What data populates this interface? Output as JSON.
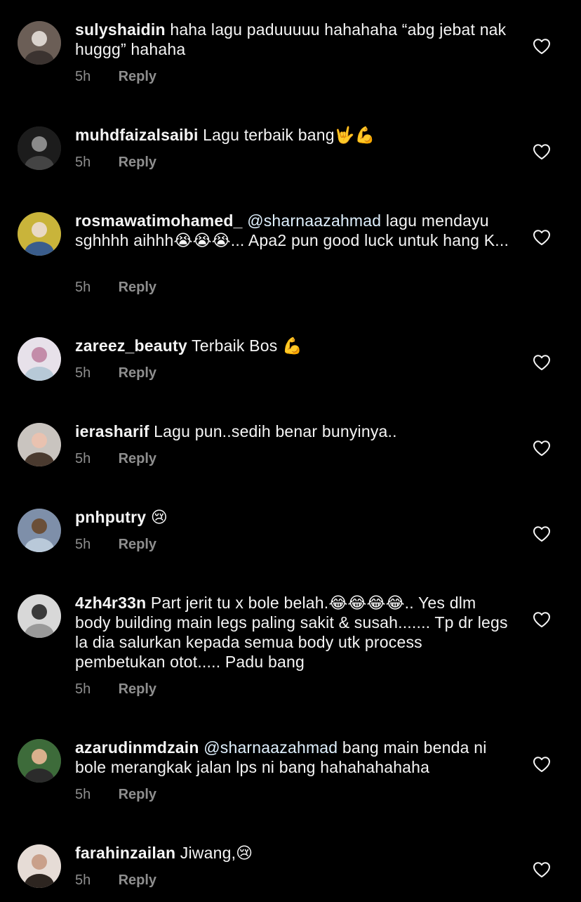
{
  "comments": [
    {
      "username": "sulyshaidin",
      "text": "haha lagu paduuuuu hahahaha “abg jebat nak huggg” hahaha",
      "time": "5h",
      "reply_label": "Reply",
      "avatar_colors": [
        "#6b5e56",
        "#d9d2cc",
        "#3b3330"
      ]
    },
    {
      "username": "muhdfaizalsaibi",
      "text": "Lagu terbaik bang🤟💪",
      "time": "5h",
      "reply_label": "Reply",
      "avatar_colors": [
        "#1c1c1c",
        "#8a8a8a",
        "#444444"
      ]
    },
    {
      "username": "rosmawatimohamed_",
      "mention": "@sharnaazahmad",
      "text": " lagu mendayu sghhhh aihhh😭😭😭... Apa2 pun good luck untuk hang K...",
      "time": "5h",
      "reply_label": "Reply",
      "avatar_colors": [
        "#c9b43a",
        "#e9d9c3",
        "#3a5d8c"
      ]
    },
    {
      "username": "zareez_beauty",
      "text": "Terbaik Bos 💪",
      "time": "5h",
      "reply_label": "Reply",
      "avatar_colors": [
        "#e7e1ea",
        "#c38ca9",
        "#b7c9d7"
      ]
    },
    {
      "username": "ierasharif",
      "text": "Lagu pun..sedih benar bunyinya..",
      "time": "5h",
      "reply_label": "Reply",
      "avatar_colors": [
        "#c9c4bf",
        "#e9c2b0",
        "#4a3a2f"
      ]
    },
    {
      "username": "pnhputry",
      "text": "😢",
      "time": "5h",
      "reply_label": "Reply",
      "avatar_colors": [
        "#7e8fa9",
        "#6b4f38",
        "#b9c9d9"
      ]
    },
    {
      "username": "4zh4r33n",
      "text": "Part jerit tu x bole belah.😂😂😂😂.. Yes dlm body building main legs paling sakit & susah....... Tp dr legs la dia salurkan kepada semua body utk process pembetukan otot..... Padu bang",
      "time": "5h",
      "reply_label": "Reply",
      "avatar_colors": [
        "#d8d8d8",
        "#3a3a3a",
        "#9a9a9a"
      ]
    },
    {
      "username": "azarudinmdzain",
      "mention": "@sharnaazahmad",
      "text": " bang main benda ni bole merangkak jalan lps ni bang hahahahahaha",
      "time": "5h",
      "reply_label": "Reply",
      "avatar_colors": [
        "#3d6b3a",
        "#d9b08c",
        "#2b2b2b"
      ]
    },
    {
      "username": "farahinzailan",
      "text": "Jiwang,😢",
      "time": "5h",
      "reply_label": "Reply",
      "avatar_colors": [
        "#e6dcd6",
        "#c9a08a",
        "#2d2520"
      ]
    }
  ],
  "colors": {
    "background": "#000000",
    "text": "#f5f5f5",
    "muted": "#8e8e8e",
    "mention": "#e0f1ff"
  },
  "icons": {
    "like": "heart-outline-icon"
  }
}
